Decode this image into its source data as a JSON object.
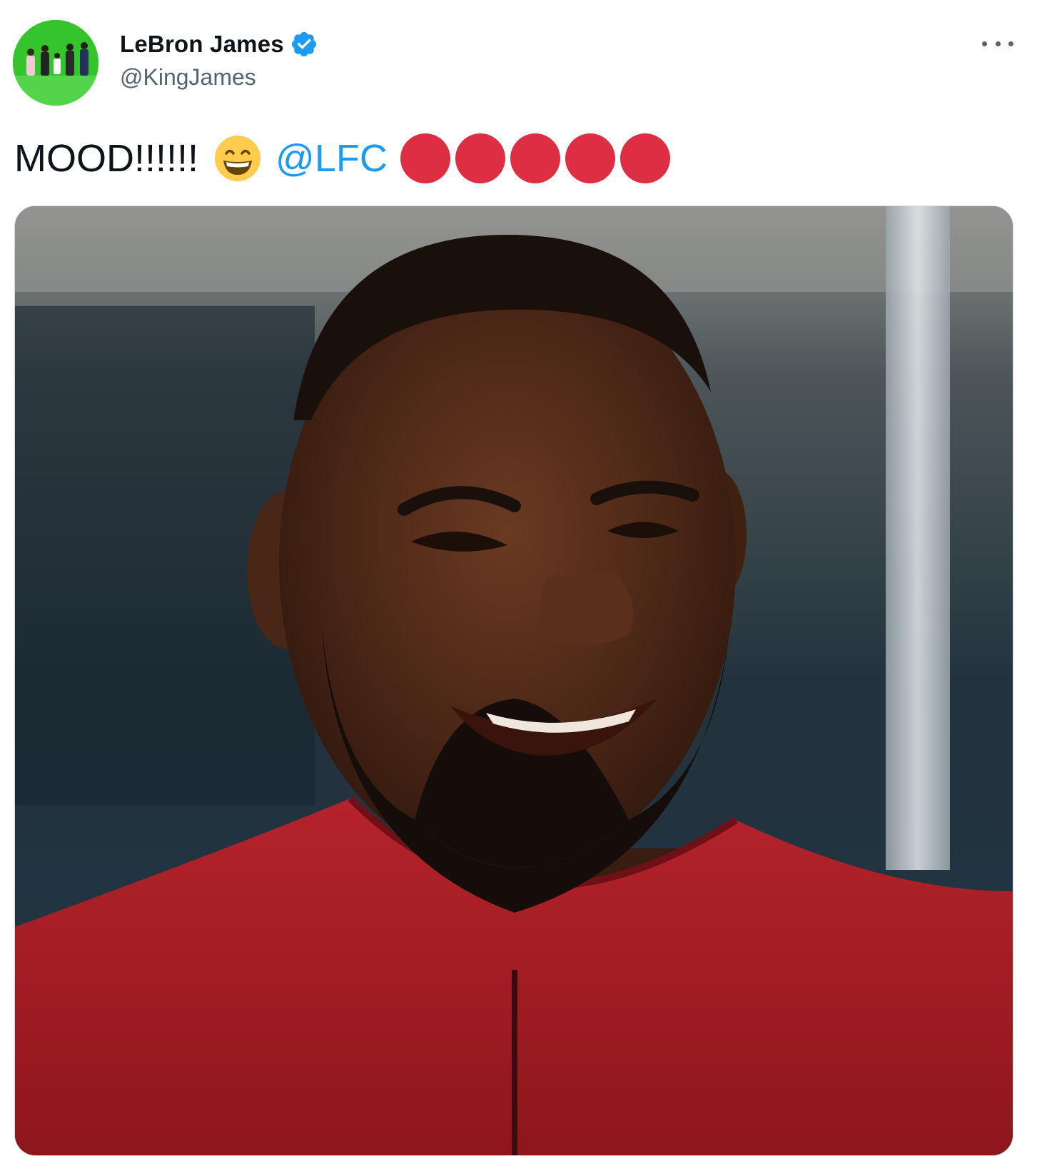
{
  "author": {
    "display_name": "LeBron James",
    "handle": "@KingJames",
    "verified": true,
    "avatar_icon": "profile-photo",
    "verified_icon": "verified-badge-icon",
    "verified_color": "#1d9bf0"
  },
  "menu": {
    "icon": "more-options-icon"
  },
  "tweet": {
    "text_prefix": "MOOD!!!!!!",
    "emoji": "😁",
    "emoji_name": "grinning-face-with-smiling-eyes-emoji",
    "mention": "@LFC",
    "mention_color": "#1d9bf0",
    "red_circles": [
      "🔴",
      "🔴",
      "🔴",
      "🔴",
      "🔴"
    ],
    "circle_color": "#dd2e44"
  },
  "media": {
    "type": "photo",
    "subject": "photo"
  }
}
